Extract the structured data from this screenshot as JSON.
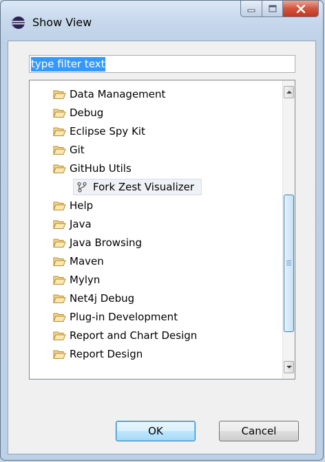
{
  "window": {
    "title": "Show View"
  },
  "filter": {
    "value": "type filter text"
  },
  "tree": {
    "items": [
      {
        "label": "Data Management",
        "type": "folder"
      },
      {
        "label": "Debug",
        "type": "folder"
      },
      {
        "label": "Eclipse Spy Kit",
        "type": "folder"
      },
      {
        "label": "Git",
        "type": "folder"
      },
      {
        "label": "GitHub Utils",
        "type": "folder"
      },
      {
        "label": "Fork Zest Visualizer",
        "type": "view"
      },
      {
        "label": "Help",
        "type": "folder"
      },
      {
        "label": "Java",
        "type": "folder"
      },
      {
        "label": "Java Browsing",
        "type": "folder"
      },
      {
        "label": "Maven",
        "type": "folder"
      },
      {
        "label": "Mylyn",
        "type": "folder"
      },
      {
        "label": "Net4j Debug",
        "type": "folder"
      },
      {
        "label": "Plug-in Development",
        "type": "folder"
      },
      {
        "label": "Report and Chart Design",
        "type": "folder"
      },
      {
        "label": "Report Design",
        "type": "folder"
      }
    ]
  },
  "buttons": {
    "ok": "OK",
    "cancel": "Cancel"
  },
  "icons": {
    "folder": "folder-open-icon",
    "view": "git-fork-icon",
    "app": "eclipse-icon"
  },
  "colors": {
    "selection": "#3399ff",
    "folder_fill": "#f4d58c",
    "folder_stroke": "#b58a32"
  }
}
